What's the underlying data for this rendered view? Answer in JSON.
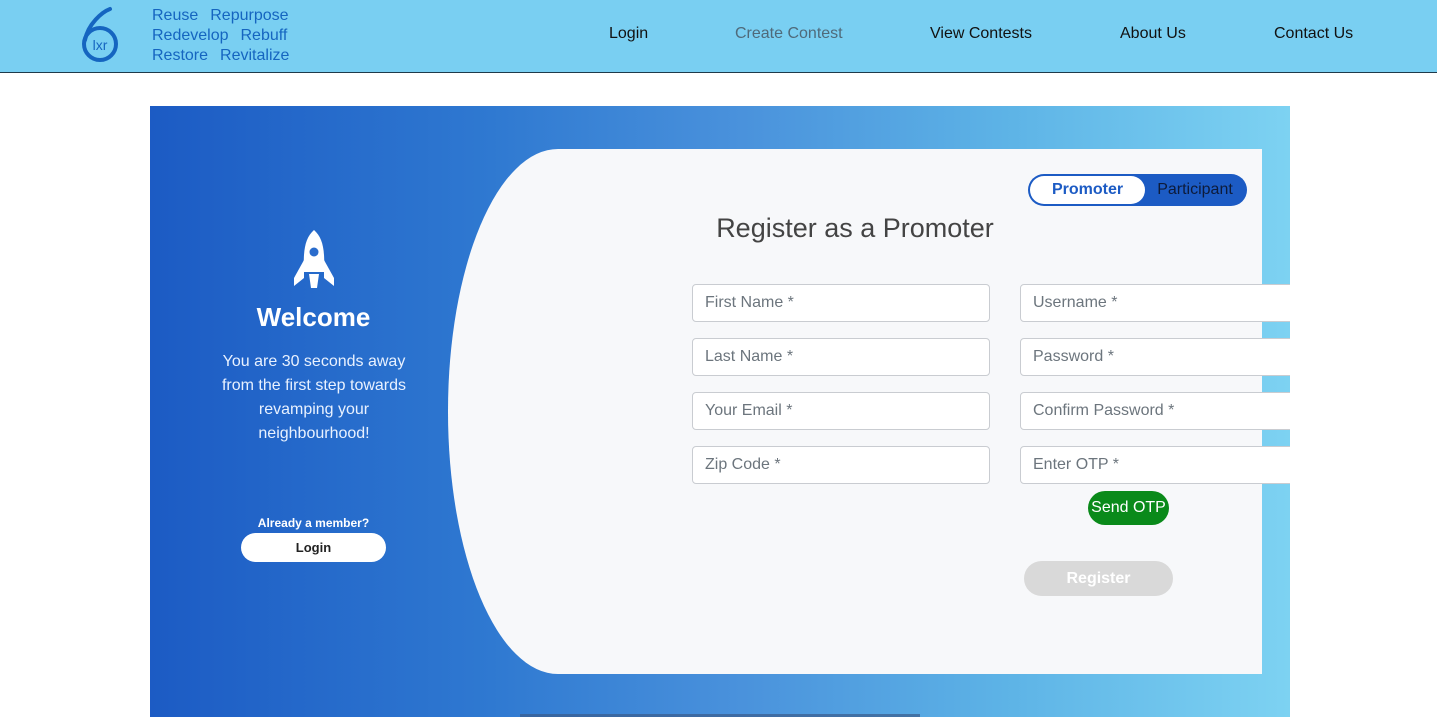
{
  "header": {
    "logo": {
      "number": "6",
      "letters": "lxr"
    },
    "tagline": [
      [
        "Reuse",
        "Repurpose"
      ],
      [
        "Redevelop",
        "Rebuff"
      ],
      [
        "Restore",
        "Revitalize"
      ]
    ],
    "nav": [
      {
        "label": "Login"
      },
      {
        "label": "Create Contest"
      },
      {
        "label": "View Contests"
      },
      {
        "label": "About Us"
      },
      {
        "label": "Contact Us"
      }
    ]
  },
  "welcome": {
    "icon": "rocket-icon",
    "title": "Welcome",
    "text": "You are 30 seconds away from the first step towards revamping your neighbourhood!",
    "already_member": "Already a member?",
    "login_label": "Login"
  },
  "form": {
    "toggle": {
      "active": "Promoter",
      "inactive": "Participant"
    },
    "title": "Register as a Promoter",
    "fields": {
      "first_name": {
        "placeholder": "First Name *",
        "value": ""
      },
      "username": {
        "placeholder": "Username *",
        "value": ""
      },
      "last_name": {
        "placeholder": "Last Name *",
        "value": ""
      },
      "password": {
        "placeholder": "Password *",
        "value": ""
      },
      "email": {
        "placeholder": "Your Email *",
        "value": ""
      },
      "confirm_password": {
        "placeholder": "Confirm Password *",
        "value": ""
      },
      "zip": {
        "placeholder": "Zip Code *",
        "value": ""
      },
      "otp": {
        "placeholder": "Enter OTP *",
        "value": ""
      }
    },
    "send_otp_label": "Send OTP",
    "register_label": "Register"
  },
  "colors": {
    "header_bg": "#79cff2",
    "brand_blue": "#1c5bc4",
    "send_otp_green": "#0a8a1a",
    "register_disabled": "#d9d9d9"
  }
}
